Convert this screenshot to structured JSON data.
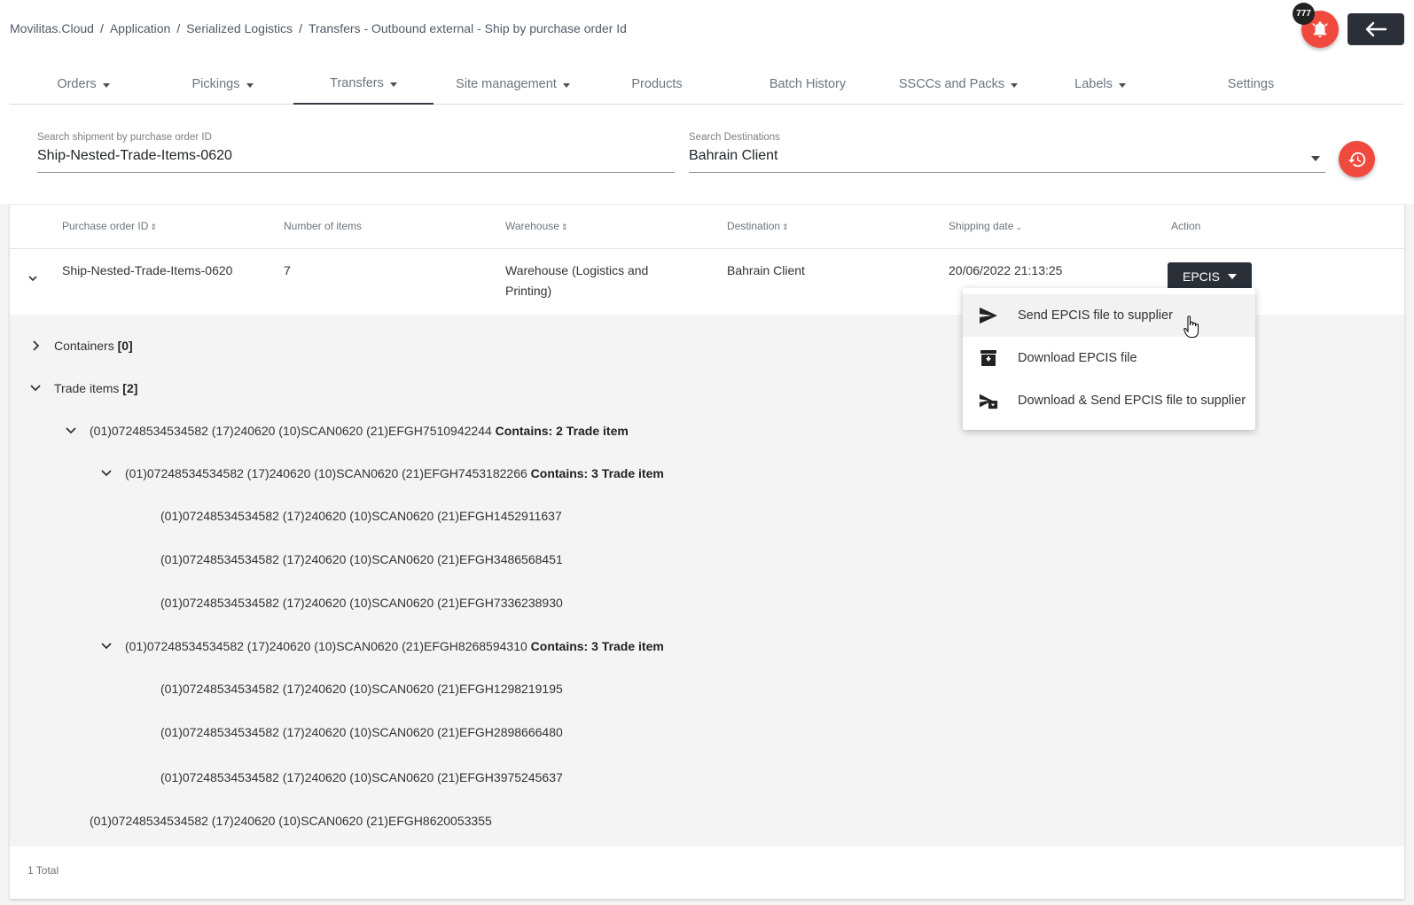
{
  "breadcrumb": [
    "Movilitas.Cloud",
    "Application",
    "Serialized Logistics",
    "Transfers - Outbound external - Ship by purchase order Id"
  ],
  "notifications": {
    "count": "777"
  },
  "nav": [
    {
      "label": "Orders"
    },
    {
      "label": "Pickings"
    },
    {
      "label": "Transfers"
    },
    {
      "label": "Site management"
    },
    {
      "label": "Products"
    },
    {
      "label": "Batch History"
    },
    {
      "label": "SSCCs and Packs"
    },
    {
      "label": "Labels"
    },
    {
      "label": "Settings"
    }
  ],
  "search": {
    "po_label": "Search shipment by purchase order ID",
    "po_value": "Ship-Nested-Trade-Items-0620",
    "dest_label": "Search Destinations",
    "dest_value": "Bahrain Client"
  },
  "table": {
    "headers": [
      "Purchase order ID",
      "Number of items",
      "Warehouse",
      "Destination",
      "Shipping date",
      "Action"
    ],
    "row": {
      "po_id": "Ship-Nested-Trade-Items-0620",
      "items": "7",
      "warehouse": "Warehouse (Logistics and Printing)",
      "destination": "Bahrain Client",
      "shipping_date": "20/06/2022 21:13:25",
      "action_label": "EPCIS"
    },
    "total": "1 Total"
  },
  "tree": {
    "containers_label": "Containers",
    "containers_count": "[0]",
    "trade_label": "Trade items",
    "trade_count": "[2]",
    "l1_a": "(01)07248534534582 (17)240620 (10)SCAN0620 (21)EFGH7510942244",
    "l1_a_contains": "Contains: 2 Trade item",
    "l2_a": "(01)07248534534582 (17)240620 (10)SCAN0620 (21)EFGH7453182266",
    "l2_a_contains": "Contains: 3 Trade item",
    "l3_a1": "(01)07248534534582 (17)240620 (10)SCAN0620 (21)EFGH1452911637",
    "l3_a2": "(01)07248534534582 (17)240620 (10)SCAN0620 (21)EFGH3486568451",
    "l3_a3": "(01)07248534534582 (17)240620 (10)SCAN0620 (21)EFGH7336238930",
    "l2_b": "(01)07248534534582 (17)240620 (10)SCAN0620 (21)EFGH8268594310",
    "l2_b_contains": "Contains: 3 Trade item",
    "l3_b1": "(01)07248534534582 (17)240620 (10)SCAN0620 (21)EFGH1298219195",
    "l3_b2": "(01)07248534534582 (17)240620 (10)SCAN0620 (21)EFGH2898666480",
    "l3_b3": "(01)07248534534582 (17)240620 (10)SCAN0620 (21)EFGH3975245637",
    "l1_b": "(01)07248534534582 (17)240620 (10)SCAN0620 (21)EFGH8620053355"
  },
  "menu": [
    {
      "label": "Send EPCIS file to supplier",
      "icon": "send-icon"
    },
    {
      "label": "Download EPCIS file",
      "icon": "archive-download-icon"
    },
    {
      "label": "Download & Send EPCIS file to supplier",
      "icon": "send-download-icon"
    }
  ],
  "colors": {
    "accent_red": "#f04a3e",
    "dark": "#2b3038"
  }
}
